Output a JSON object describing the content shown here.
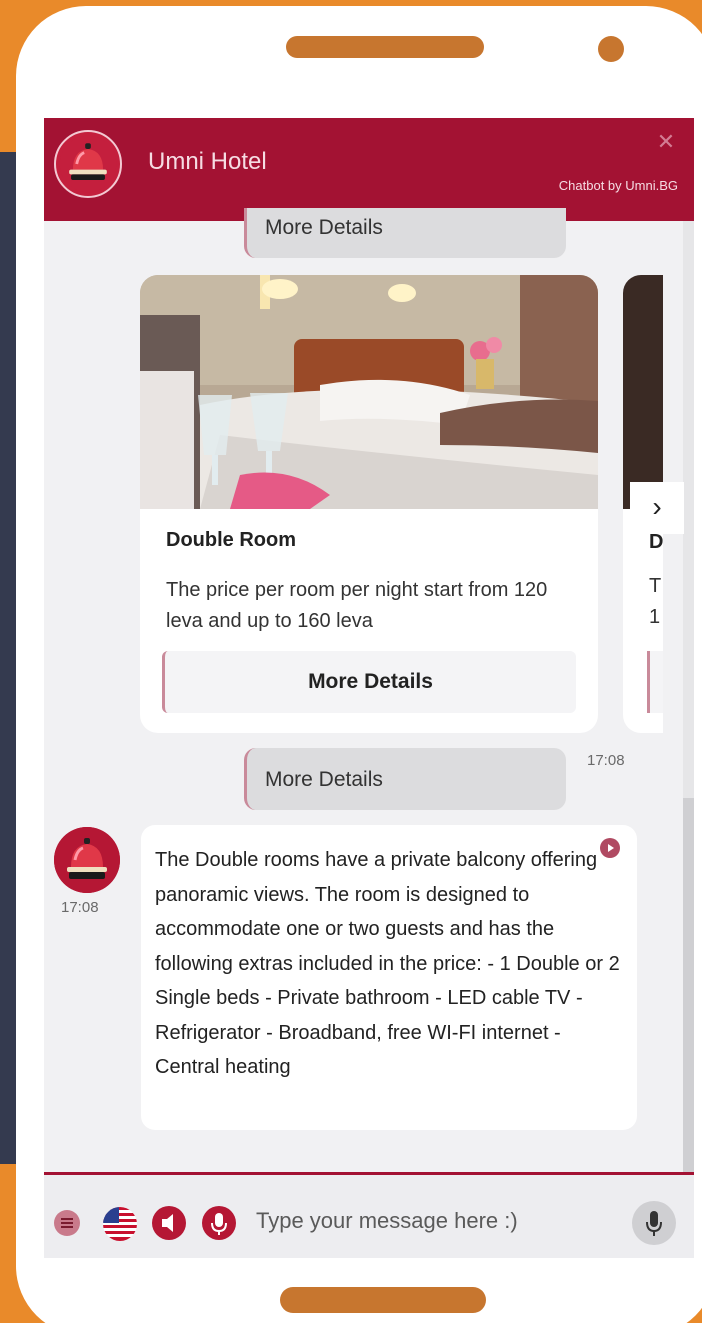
{
  "header": {
    "title": "Umni Hotel",
    "credit": "Chatbot by Umni.BG",
    "close_symbol": "✕"
  },
  "messages": {
    "previous_chip": "More Details",
    "user_chip": "More Details",
    "user_time": "17:08",
    "bot_time": "17:08",
    "bot_text": "The Double rooms have a private balcony offering panoramic views. The room is designed to accommodate one or two guests and has the following extras included in the price: - 1 Double or 2 Single beds - Private bathroom - LED cable TV - Refrigerator - Broadband, free WI-FI internet - Central heating"
  },
  "carousel": {
    "cards": [
      {
        "title": "Double Room",
        "description": "The price per room per night start from 120 leva and up to 160 leva",
        "button": "More Details"
      },
      {
        "title_visible": "D",
        "line1_visible": "T",
        "line2_visible": "1"
      }
    ],
    "next_symbol": "›"
  },
  "input": {
    "placeholder": "Type your message here :)"
  },
  "colors": {
    "brand": "#a31233",
    "accent_border": "#c98a9a",
    "frame": "#e98a2a"
  },
  "icons": [
    "bell-icon",
    "close-icon",
    "chevron-right-icon",
    "play-icon",
    "menu-icon",
    "us-flag-icon",
    "speaker-icon",
    "microphone-icon"
  ]
}
